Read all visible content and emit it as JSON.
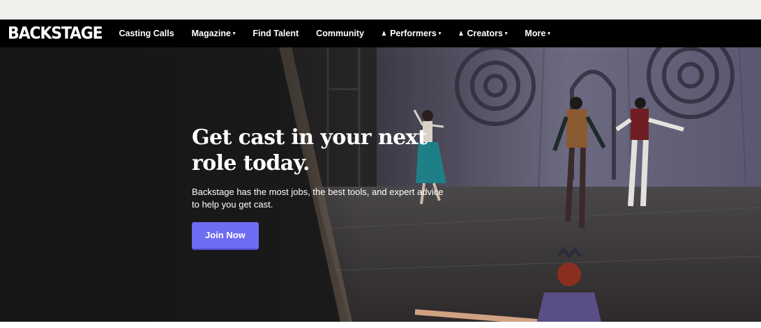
{
  "nav": {
    "logo": "BACKSTAGE",
    "items": [
      {
        "label": "Casting Calls"
      },
      {
        "label": "Magazine",
        "caret": "▾"
      },
      {
        "label": "Find Talent"
      },
      {
        "label": "Community"
      },
      {
        "label": "Performers",
        "caret": "▾",
        "person": "♟"
      },
      {
        "label": "Creators",
        "caret": "▾",
        "person": "♟"
      },
      {
        "label": "More",
        "caret": "▾"
      }
    ]
  },
  "hero": {
    "title_line1": "Get cast in your next",
    "title_line2": "role today.",
    "subtitle": "Backstage has the most jobs, the best tools, and expert advice to help you get cast.",
    "cta_label": "Join Now"
  },
  "colors": {
    "nav_bg": "#000000",
    "cta_bg": "#6e6cf2",
    "page_bg": "#f1f0ec"
  }
}
